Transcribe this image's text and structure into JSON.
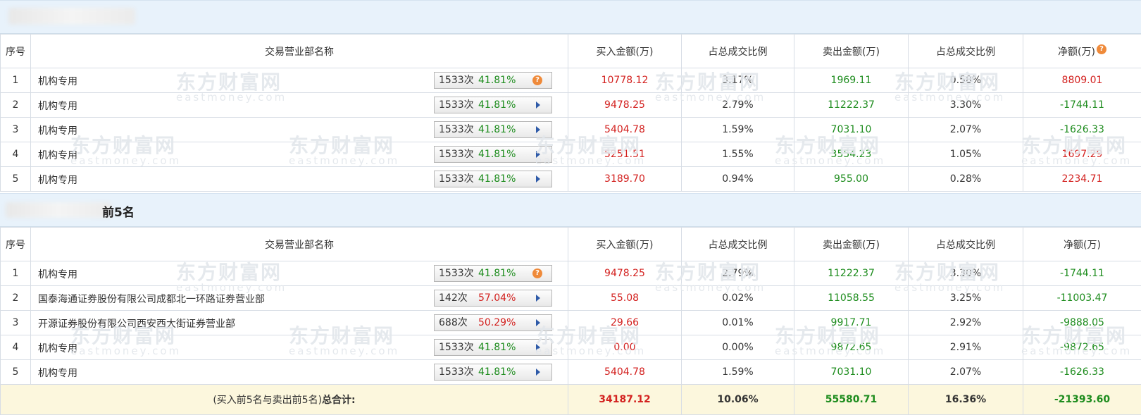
{
  "watermark": {
    "cn": "东方财富网",
    "en": "eastmoney.com"
  },
  "section2_title": "前5名",
  "columns": {
    "seq": "序号",
    "name": "交易营业部名称",
    "buy": "买入金额(万)",
    "buy_pct": "占总成交比例",
    "sell": "卖出金额(万)",
    "sell_pct": "占总成交比例",
    "net": "净额(万)"
  },
  "icons": {
    "help": "?",
    "help_icon": "question-circle-icon",
    "expand_icon": "right-triangle-icon"
  },
  "colors": {
    "up": "#d3211f",
    "down": "#1d8c1d",
    "help": "#ef8a3a",
    "arrow": "#2e5aa8",
    "band": "#e8f2fb",
    "total_bg": "#fcf7dd"
  },
  "buy_table": [
    {
      "seq": "1",
      "name": "机构专用",
      "count": "1533次",
      "pct": "41.81%",
      "pct_color": "green",
      "icon": "help",
      "buy": "10778.12",
      "buy_pct": "3.17%",
      "sell": "1969.11",
      "sell_pct": "0.58%",
      "net": "8809.01",
      "net_color": "red"
    },
    {
      "seq": "2",
      "name": "机构专用",
      "count": "1533次",
      "pct": "41.81%",
      "pct_color": "green",
      "icon": "arrow",
      "buy": "9478.25",
      "buy_pct": "2.79%",
      "sell": "11222.37",
      "sell_pct": "3.30%",
      "net": "-1744.11",
      "net_color": "green"
    },
    {
      "seq": "3",
      "name": "机构专用",
      "count": "1533次",
      "pct": "41.81%",
      "pct_color": "green",
      "icon": "arrow",
      "buy": "5404.78",
      "buy_pct": "1.59%",
      "sell": "7031.10",
      "sell_pct": "2.07%",
      "net": "-1626.33",
      "net_color": "green"
    },
    {
      "seq": "4",
      "name": "机构专用",
      "count": "1533次",
      "pct": "41.81%",
      "pct_color": "green",
      "icon": "arrow",
      "buy": "5251.51",
      "buy_pct": "1.55%",
      "sell": "3554.23",
      "sell_pct": "1.05%",
      "net": "1697.29",
      "net_color": "red"
    },
    {
      "seq": "5",
      "name": "机构专用",
      "count": "1533次",
      "pct": "41.81%",
      "pct_color": "green",
      "icon": "arrow",
      "buy": "3189.70",
      "buy_pct": "0.94%",
      "sell": "955.00",
      "sell_pct": "0.28%",
      "net": "2234.71",
      "net_color": "red"
    }
  ],
  "sell_table": [
    {
      "seq": "1",
      "name": "机构专用",
      "count": "1533次",
      "pct": "41.81%",
      "pct_color": "green",
      "icon": "help",
      "buy": "9478.25",
      "buy_pct": "2.79%",
      "sell": "11222.37",
      "sell_pct": "3.30%",
      "net": "-1744.11",
      "net_color": "green"
    },
    {
      "seq": "2",
      "name": "国泰海通证券股份有限公司成都北一环路证券营业部",
      "count": "142次",
      "pct": "57.04%",
      "pct_color": "red",
      "icon": "arrow",
      "buy": "55.08",
      "buy_pct": "0.02%",
      "sell": "11058.55",
      "sell_pct": "3.25%",
      "net": "-11003.47",
      "net_color": "green"
    },
    {
      "seq": "3",
      "name": "开源证券股份有限公司西安西大街证券营业部",
      "count": "688次",
      "pct": "50.29%",
      "pct_color": "red",
      "icon": "arrow",
      "buy": "29.66",
      "buy_pct": "0.01%",
      "sell": "9917.71",
      "sell_pct": "2.92%",
      "net": "-9888.05",
      "net_color": "green"
    },
    {
      "seq": "4",
      "name": "机构专用",
      "count": "1533次",
      "pct": "41.81%",
      "pct_color": "green",
      "icon": "arrow",
      "buy": "0.00",
      "buy_pct": "0.00%",
      "sell": "9872.65",
      "sell_pct": "2.91%",
      "net": "-9872.65",
      "net_color": "green"
    },
    {
      "seq": "5",
      "name": "机构专用",
      "count": "1533次",
      "pct": "41.81%",
      "pct_color": "green",
      "icon": "arrow",
      "buy": "5404.78",
      "buy_pct": "1.59%",
      "sell": "7031.10",
      "sell_pct": "2.07%",
      "net": "-1626.33",
      "net_color": "green"
    }
  ],
  "total": {
    "label_prefix": "(买入前5名与卖出前5名)",
    "label_suffix": "总合计:",
    "buy": "34187.12",
    "buy_pct": "10.06%",
    "sell": "55580.71",
    "sell_pct": "16.36%",
    "net": "-21393.60"
  }
}
